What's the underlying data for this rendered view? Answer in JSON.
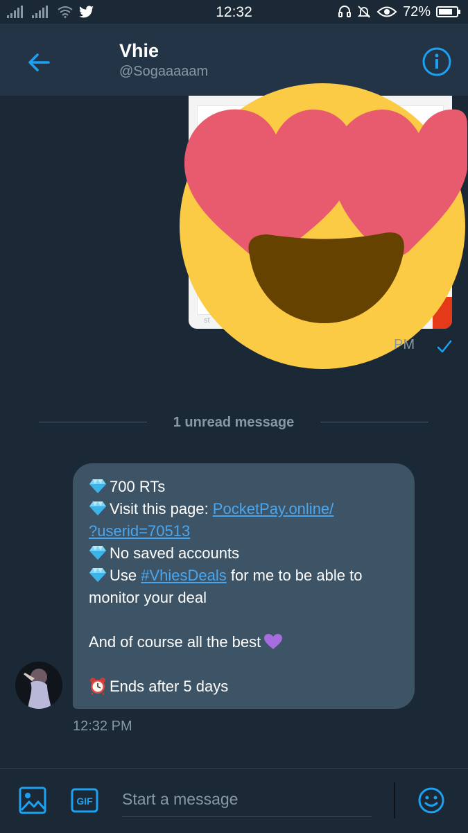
{
  "status_bar": {
    "time": "12:32",
    "battery": "72%",
    "icons": [
      "signal-icon",
      "signal-icon",
      "wifi-icon",
      "twitter-icon",
      "headphones-icon",
      "mute-icon",
      "eye-icon",
      "battery-icon"
    ]
  },
  "header": {
    "name": "Vhie",
    "handle": "@Sogaaaaam",
    "back_icon": "arrow-left-icon",
    "info_icon": "info-icon"
  },
  "conversation": {
    "sent_time_partial": "PM",
    "unread_label": "1 unread message",
    "message": {
      "line1": "700 RTs",
      "line2_text": "Visit this page: ",
      "line2_link": "PocketPay.online/",
      "line3_link": "?userid=70513",
      "line4": "No saved accounts",
      "line5_text": "Use ",
      "line5_link": "#VhiesDeals",
      "line5_rest": " for me to be able to",
      "line6": "monitor your deal",
      "line7": "And of course all the best",
      "line8": "Ends after 5 days"
    },
    "received_time": "12:32 PM"
  },
  "composer": {
    "placeholder": "Start a message",
    "gif_label": "GIF"
  },
  "colors": {
    "background": "#1b2836",
    "header": "#243447",
    "bubble": "#3d5466",
    "accent": "#1da1f2",
    "link": "#4aa6ef",
    "muted": "#8899a6"
  }
}
